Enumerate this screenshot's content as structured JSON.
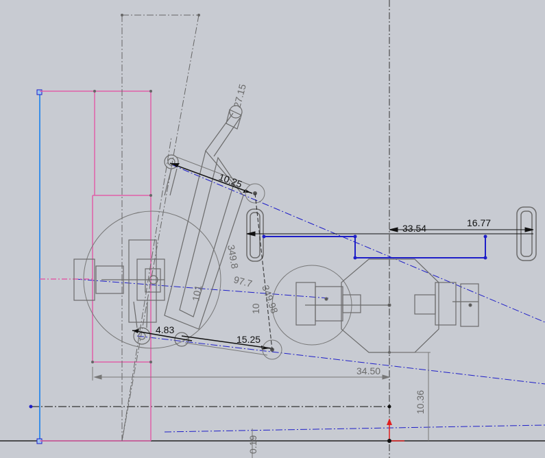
{
  "dimensions": {
    "d_27_15": "27.15",
    "d_10_25": "10.25",
    "d_33_54": "33.54",
    "d_16_77": "16.77",
    "d_349_8": "349.8",
    "d_97_7": "97.7",
    "d_349_98": "349.98",
    "d_101": "101",
    "d_10": "10",
    "d_4_83": "4.83",
    "d_15_25": "15.25",
    "d_34_50": "34.50",
    "d_10_36": "10.36",
    "d_0_19": "0.19"
  },
  "colors": {
    "background": "#c8cbd2",
    "geometry": "#7a7a7a",
    "centerline": "#555555",
    "selected": "#1e1ec8",
    "construction": "#e060a8",
    "sketch_blue": "#3a8ee8",
    "origin": "#e02020"
  }
}
